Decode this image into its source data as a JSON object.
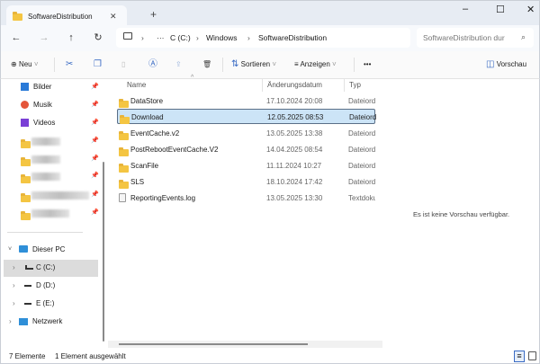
{
  "window": {
    "tab_title": "SoftwareDistribution",
    "new_tab": "+",
    "minimize": "–",
    "maximize": "☐",
    "close": "✕",
    "tab_close": "✕"
  },
  "nav": {
    "back": "←",
    "forward": "→",
    "up": "↑",
    "refresh": "↻",
    "ellipsis": "···",
    "breadcrumb": [
      "C (C:)",
      "Windows",
      "SoftwareDistribution"
    ],
    "search_placeholder": "SoftwareDistribution dur"
  },
  "toolbar": {
    "new_label": "Neu",
    "sort_label": "Sortieren",
    "view_label": "Anzeigen",
    "more": "•••",
    "preview_label": "Vorschau"
  },
  "sidebar": {
    "quick": [
      {
        "label": "Bilder",
        "color": "#2a7ad8"
      },
      {
        "label": "Musik",
        "color": "#e4553a"
      },
      {
        "label": "Videos",
        "color": "#7a3fd6"
      }
    ],
    "this_pc": "Dieser PC",
    "drives": [
      "C (C:)",
      "D (D:)",
      "E (E:)"
    ],
    "network": "Netzwerk"
  },
  "columns": {
    "name": "Name",
    "date": "Änderungsdatum",
    "type": "Typ"
  },
  "files": [
    {
      "name": "DataStore",
      "date": "17.10.2024 20:08",
      "type": "Dateiordner",
      "kind": "folder"
    },
    {
      "name": "Download",
      "date": "12.05.2025 08:53",
      "type": "Dateiordner",
      "kind": "folder",
      "selected": true
    },
    {
      "name": "EventCache.v2",
      "date": "13.05.2025 13:38",
      "type": "Dateiordner",
      "kind": "folder"
    },
    {
      "name": "PostRebootEventCache.V2",
      "date": "14.04.2025 08:54",
      "type": "Dateiordner",
      "kind": "folder"
    },
    {
      "name": "ScanFile",
      "date": "11.11.2024 10:27",
      "type": "Dateiordner",
      "kind": "folder"
    },
    {
      "name": "SLS",
      "date": "18.10.2024 17:42",
      "type": "Dateiordner",
      "kind": "folder"
    },
    {
      "name": "ReportingEvents.log",
      "date": "13.05.2025 13:30",
      "type": "Textdokument",
      "kind": "file"
    }
  ],
  "preview": {
    "empty_text": "Es ist keine Vorschau verfügbar."
  },
  "status": {
    "count": "7 Elemente",
    "selection": "1 Element ausgewählt"
  }
}
